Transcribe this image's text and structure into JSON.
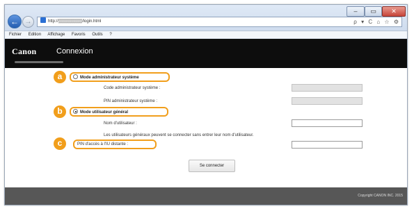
{
  "browser": {
    "url": "http://▒▒▒▒▒▒▒▒/login.html",
    "address_tools": [
      "ρ",
      "▾",
      "C"
    ],
    "toolbar_icons": [
      "home-icon",
      "star-icon",
      "gear-icon"
    ],
    "window_controls": [
      "–",
      "▭",
      "✕"
    ],
    "menu": [
      "Fichier",
      "Edition",
      "Affichage",
      "Favoris",
      "Outils",
      "?"
    ]
  },
  "header": {
    "logo": "Canon",
    "title": "Connexion"
  },
  "form": {
    "admin_mode_label": "Mode administrateur système",
    "admin_code_label": "Code administrateur système :",
    "admin_pin_label": "PIN administrateur système :",
    "user_mode_label": "Mode utilisateur général",
    "username_label": "Nom d'utilisateur :",
    "note": "Les utilisateurs généraux peuvent se connecter sans entrer leur nom d'utilisateur.",
    "remote_pin_label": "PIN d'accès à l'IU distante :",
    "submit_label": "Se connecter",
    "selected_mode": "user"
  },
  "markers": {
    "a": "a",
    "b": "b",
    "c": "c"
  },
  "footer": {
    "copyright": "Copyright CANON INC. 2015"
  },
  "colors": {
    "marker": "#f19e1b",
    "header_bg": "#0d0d0d",
    "footer_bg": "#575757"
  }
}
